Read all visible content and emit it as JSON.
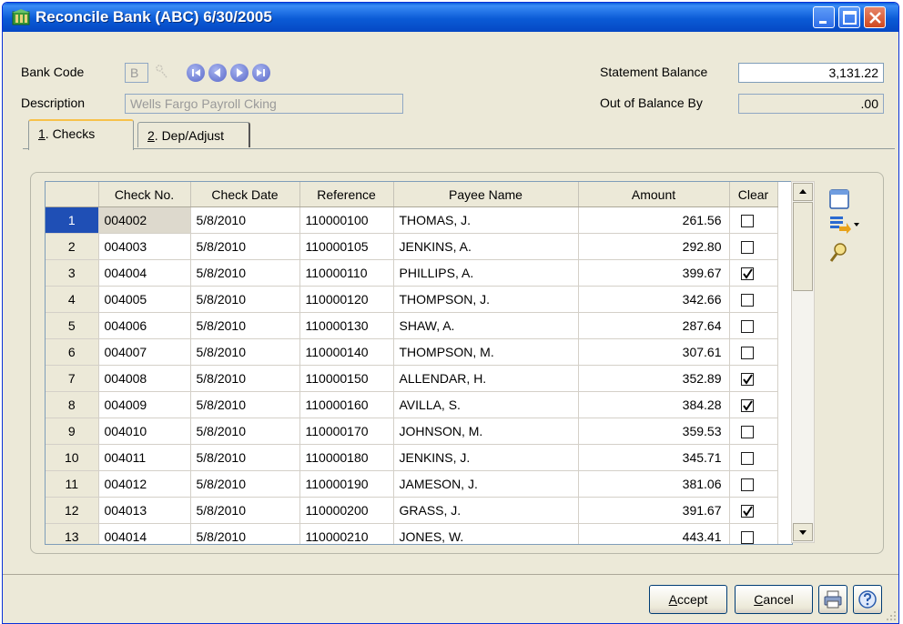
{
  "window": {
    "title": "Reconcile Bank (ABC) 6/30/2005"
  },
  "header": {
    "bank_code_label": "Bank Code",
    "bank_code_value": "B",
    "description_label": "Description",
    "description_value": "Wells Fargo Payroll Cking",
    "statement_balance_label": "Statement Balance",
    "statement_balance_value": "3,131.22",
    "out_of_balance_label": "Out of Balance By",
    "out_of_balance_value": ".00"
  },
  "tabs": [
    {
      "mnemonic": "1",
      "label": ". Checks",
      "active": true
    },
    {
      "mnemonic": "2",
      "label": ". Dep/Adjust",
      "active": false
    }
  ],
  "grid": {
    "columns": [
      "",
      "Check No.",
      "Check Date",
      "Reference",
      "Payee Name",
      "Amount",
      "Clear"
    ],
    "rows": [
      {
        "num": "1",
        "check_no": "004002",
        "date": "5/8/2010",
        "ref": "110000100",
        "payee": "THOMAS, J.",
        "amount": "261.56",
        "clear": false
      },
      {
        "num": "2",
        "check_no": "004003",
        "date": "5/8/2010",
        "ref": "110000105",
        "payee": "JENKINS, A.",
        "amount": "292.80",
        "clear": false
      },
      {
        "num": "3",
        "check_no": "004004",
        "date": "5/8/2010",
        "ref": "110000110",
        "payee": "PHILLIPS, A.",
        "amount": "399.67",
        "clear": true
      },
      {
        "num": "4",
        "check_no": "004005",
        "date": "5/8/2010",
        "ref": "110000120",
        "payee": "THOMPSON, J.",
        "amount": "342.66",
        "clear": false
      },
      {
        "num": "5",
        "check_no": "004006",
        "date": "5/8/2010",
        "ref": "110000130",
        "payee": "SHAW, A.",
        "amount": "287.64",
        "clear": false
      },
      {
        "num": "6",
        "check_no": "004007",
        "date": "5/8/2010",
        "ref": "110000140",
        "payee": "THOMPSON, M.",
        "amount": "307.61",
        "clear": false
      },
      {
        "num": "7",
        "check_no": "004008",
        "date": "5/8/2010",
        "ref": "110000150",
        "payee": "ALLENDAR, H.",
        "amount": "352.89",
        "clear": true
      },
      {
        "num": "8",
        "check_no": "004009",
        "date": "5/8/2010",
        "ref": "110000160",
        "payee": "AVILLA, S.",
        "amount": "384.28",
        "clear": true
      },
      {
        "num": "9",
        "check_no": "004010",
        "date": "5/8/2010",
        "ref": "110000170",
        "payee": "JOHNSON, M.",
        "amount": "359.53",
        "clear": false
      },
      {
        "num": "10",
        "check_no": "004011",
        "date": "5/8/2010",
        "ref": "110000180",
        "payee": "JENKINS, J.",
        "amount": "345.71",
        "clear": false
      },
      {
        "num": "11",
        "check_no": "004012",
        "date": "5/8/2010",
        "ref": "110000190",
        "payee": "JAMESON, J.",
        "amount": "381.06",
        "clear": false
      },
      {
        "num": "12",
        "check_no": "004013",
        "date": "5/8/2010",
        "ref": "110000200",
        "payee": "GRASS, J.",
        "amount": "391.67",
        "clear": true
      },
      {
        "num": "13",
        "check_no": "004014",
        "date": "5/8/2010",
        "ref": "110000210",
        "payee": "JONES, W.",
        "amount": "443.41",
        "clear": false
      }
    ]
  },
  "footer": {
    "accept_mnemonic": "A",
    "accept_rest": "ccept",
    "cancel_mnemonic": "C",
    "cancel_rest": "ancel"
  },
  "icons": {
    "app": "bank-reconcile-icon",
    "nav": [
      "first-record-icon",
      "previous-record-icon",
      "next-record-icon",
      "last-record-icon"
    ],
    "side": [
      "grid-settings-icon",
      "export-icon",
      "find-icon"
    ],
    "footer": [
      "print-icon",
      "help-icon"
    ]
  },
  "colors": {
    "titlebar": "#0b5bd6",
    "selected_row": "#1f4fb5",
    "window_bg": "#ece9d8"
  }
}
